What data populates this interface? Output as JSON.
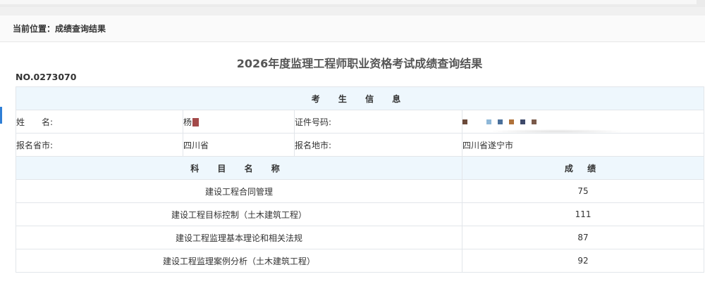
{
  "breadcrumb": "当前位置：成绩查询结果",
  "title": "2026年度监理工程师职业资格考试成绩查询结果",
  "serial": "NO.0273070",
  "candidate_info": {
    "header": "考 生 信 息",
    "name_label": "姓　　名:",
    "name_value": "杨",
    "id_label": "证件号码:",
    "id_redaction_colors": [
      "#6b4a3a",
      "#8fb8d8",
      "#4a6f9a",
      "#b0723a",
      "#3e4a6a",
      "#7a5a4a"
    ],
    "province_label": "报名省市:",
    "province_value": "四川省",
    "city_label": "报名地市:",
    "city_value": "四川省遂宁市"
  },
  "scores": {
    "subject_header": "科 目 名 称",
    "score_header": "成 绩",
    "rows": [
      {
        "subject": "建设工程合同管理",
        "score": "75"
      },
      {
        "subject": "建设工程目标控制（土木建筑工程）",
        "score": "111"
      },
      {
        "subject": "建设工程监理基本理论和相关法规",
        "score": "87"
      },
      {
        "subject": "建设工程监理案例分析（土木建筑工程）",
        "score": "92"
      }
    ]
  }
}
